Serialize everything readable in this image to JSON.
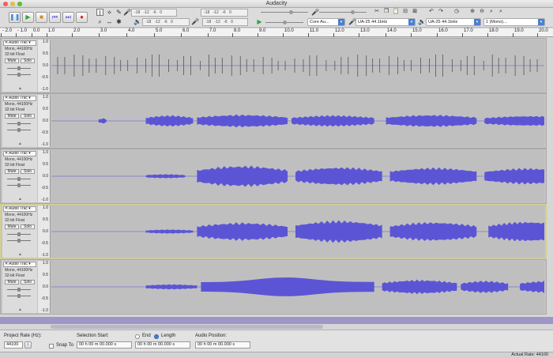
{
  "window": {
    "title": "Audacity"
  },
  "transport": {
    "pause": "❚❚",
    "play": "▶",
    "stop": "■",
    "skip_start": "⏮",
    "skip_end": "⏭",
    "record": "●"
  },
  "meters": {
    "row1_scale": "-18 -12 -6 0",
    "row2_scale": "-18 -12 -6 0",
    "row1b_scale": "-18 -12 -6 0",
    "lr_scale": "-18 -12 -6 0"
  },
  "devices": {
    "host": "Core Au...",
    "input": "UA-25 44.1kHz",
    "output": "UA-25 44.1kHz",
    "channels": "1 (Mono)..."
  },
  "ruler": {
    "labels": [
      "- 2.0",
      "- 1.0",
      "0.0",
      "1.0",
      "2.0",
      "3.0",
      "4.0",
      "5.0",
      "6.0",
      "7.0",
      "8.0",
      "9.0",
      "10.0",
      "11.0",
      "12.0",
      "13.0",
      "14.0",
      "15.0",
      "16.0",
      "17.0",
      "18.0",
      "19.0",
      "20.0"
    ]
  },
  "tracks": [
    {
      "name": "Audio Trac",
      "line1": "Mono, 44100Hz",
      "line2": "32-bit Float",
      "mute": "Mute",
      "solo": "Solo",
      "scale": [
        "1.0",
        "0.5",
        "0.0",
        "-0.5",
        "-1.0"
      ]
    },
    {
      "name": "Audio Trac",
      "line1": "Mono, 44100Hz",
      "line2": "32-bit Float",
      "mute": "Mute",
      "solo": "Solo",
      "scale": [
        "1.0",
        "0.5",
        "0.0",
        "-0.5",
        "-1.0"
      ]
    },
    {
      "name": "Audio Trac",
      "line1": "Mono, 44100Hz",
      "line2": "32-bit Float",
      "mute": "Mute",
      "solo": "Solo",
      "scale": [
        "1.0",
        "0.5",
        "0.0",
        "-0.5",
        "-1.0"
      ]
    },
    {
      "name": "Audio Trac",
      "line1": "Mono, 44100Hz",
      "line2": "32-bit Float",
      "mute": "Mute",
      "solo": "Solo",
      "scale": [
        "1.0",
        "0.5",
        "0.0",
        "-0.5",
        "-1.0"
      ]
    },
    {
      "name": "Audio Trac",
      "line1": "Mono, 44100Hz",
      "line2": "32-bit Float",
      "mute": "Mute",
      "solo": "Solo",
      "scale": [
        "1.0",
        "0.5",
        "0.0",
        "-0.5",
        "-1.0"
      ]
    }
  ],
  "selection": {
    "project_rate_label": "Project Rate (Hz):",
    "project_rate": "44100",
    "snap_label": "Snap To",
    "selection_start_label": "Selection Start:",
    "selection_start": "00 h 00 m 00.000 s",
    "end_label": "End",
    "length_label": "Length",
    "length_value": "00 h 00 m 00.000 s",
    "audio_position_label": "Audio Position:",
    "audio_position": "00 h 00 m 00.000 s"
  },
  "status": {
    "actual_rate": "Actual Rate: 44100"
  },
  "colors": {
    "waveform": "#5b55d6",
    "selected_border": "#d6d28a"
  }
}
